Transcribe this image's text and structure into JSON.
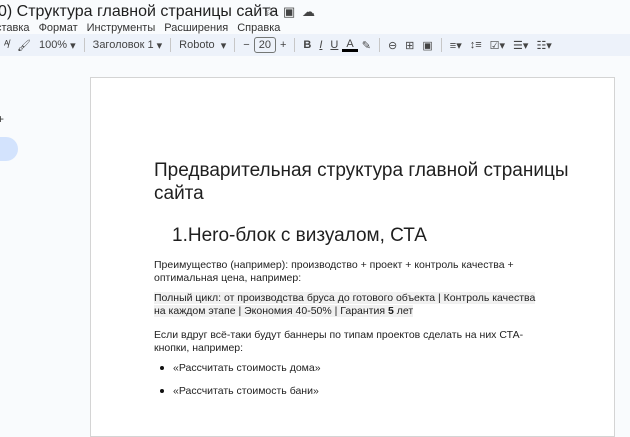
{
  "doc_title": "0) Структура главной страницы сайта",
  "menu": [
    "ставка",
    "Формат",
    "Инструменты",
    "Расширения",
    "Справка"
  ],
  "toolbar": {
    "zoom": "100%",
    "style": "Заголовок 1",
    "font": "Roboto",
    "font_size": "20",
    "minus": "−",
    "plus": "+",
    "bold": "B",
    "italic": "I",
    "underline": "U",
    "text_color": "A"
  },
  "document": {
    "title_line1": "Предварительная структура главной страницы",
    "title_line2": "сайта",
    "heading": "1.Hero-блок с визуалом, СТА",
    "para1": "Преимущество (например): производство + проект + контроль качества + оптимальная цена, например:",
    "para2_a": "Полный цикл: от производства бруса до готового объекта | Контроль качества на каждом этапе | Экономия 40-50% | Гарантия ",
    "para2_bold": "5",
    "para2_b": " лет",
    "para3": "Если вдруг всё-таки будут баннеры по типам проектов сделать на них СТА-кнопки, например:",
    "bullets": [
      "«Рассчитать стоимость дома»",
      "«Рассчитать стоимость бани»"
    ]
  }
}
